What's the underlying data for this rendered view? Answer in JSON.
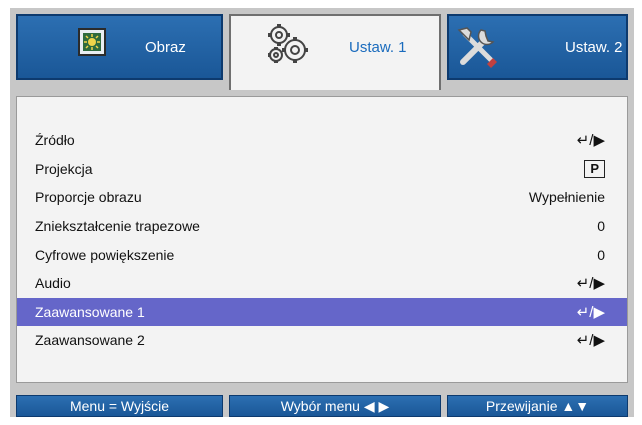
{
  "tabs": [
    {
      "label": "Obraz",
      "icon": "image-icon",
      "active": false
    },
    {
      "label": "Ustaw. 1",
      "icon": "gears-icon",
      "active": true
    },
    {
      "label": "Ustaw. 2",
      "icon": "tools-icon",
      "active": false
    }
  ],
  "menu": {
    "items": [
      {
        "label": "Źródło",
        "value": "↵/▶",
        "value_type": "enter"
      },
      {
        "label": "Projekcja",
        "value": "P",
        "value_type": "boxed"
      },
      {
        "label": "Proporcje obrazu",
        "value": "Wypełnienie",
        "value_type": "text"
      },
      {
        "label": "Zniekształcenie trapezowe",
        "value": "0",
        "value_type": "text"
      },
      {
        "label": "Cyfrowe powiększenie",
        "value": "0",
        "value_type": "text"
      },
      {
        "label": "Audio",
        "value": "↵/▶",
        "value_type": "enter"
      },
      {
        "label": "Zaawansowane 1",
        "value": "↵/▶",
        "value_type": "enter",
        "selected": true
      },
      {
        "label": "Zaawansowane 2",
        "value": "↵/▶",
        "value_type": "enter"
      }
    ]
  },
  "footer": {
    "hints": [
      {
        "label": "Menu = Wyjście"
      },
      {
        "label": "Wybór menu ◀ ▶"
      },
      {
        "label": "Przewijanie ▲▼"
      }
    ]
  },
  "colors": {
    "tab_blue": "#1a5797",
    "active_tab_text": "#1a6bbd",
    "selection": "#6566c9",
    "frame": "#c7c7c7",
    "panel": "#f3f3f3"
  }
}
